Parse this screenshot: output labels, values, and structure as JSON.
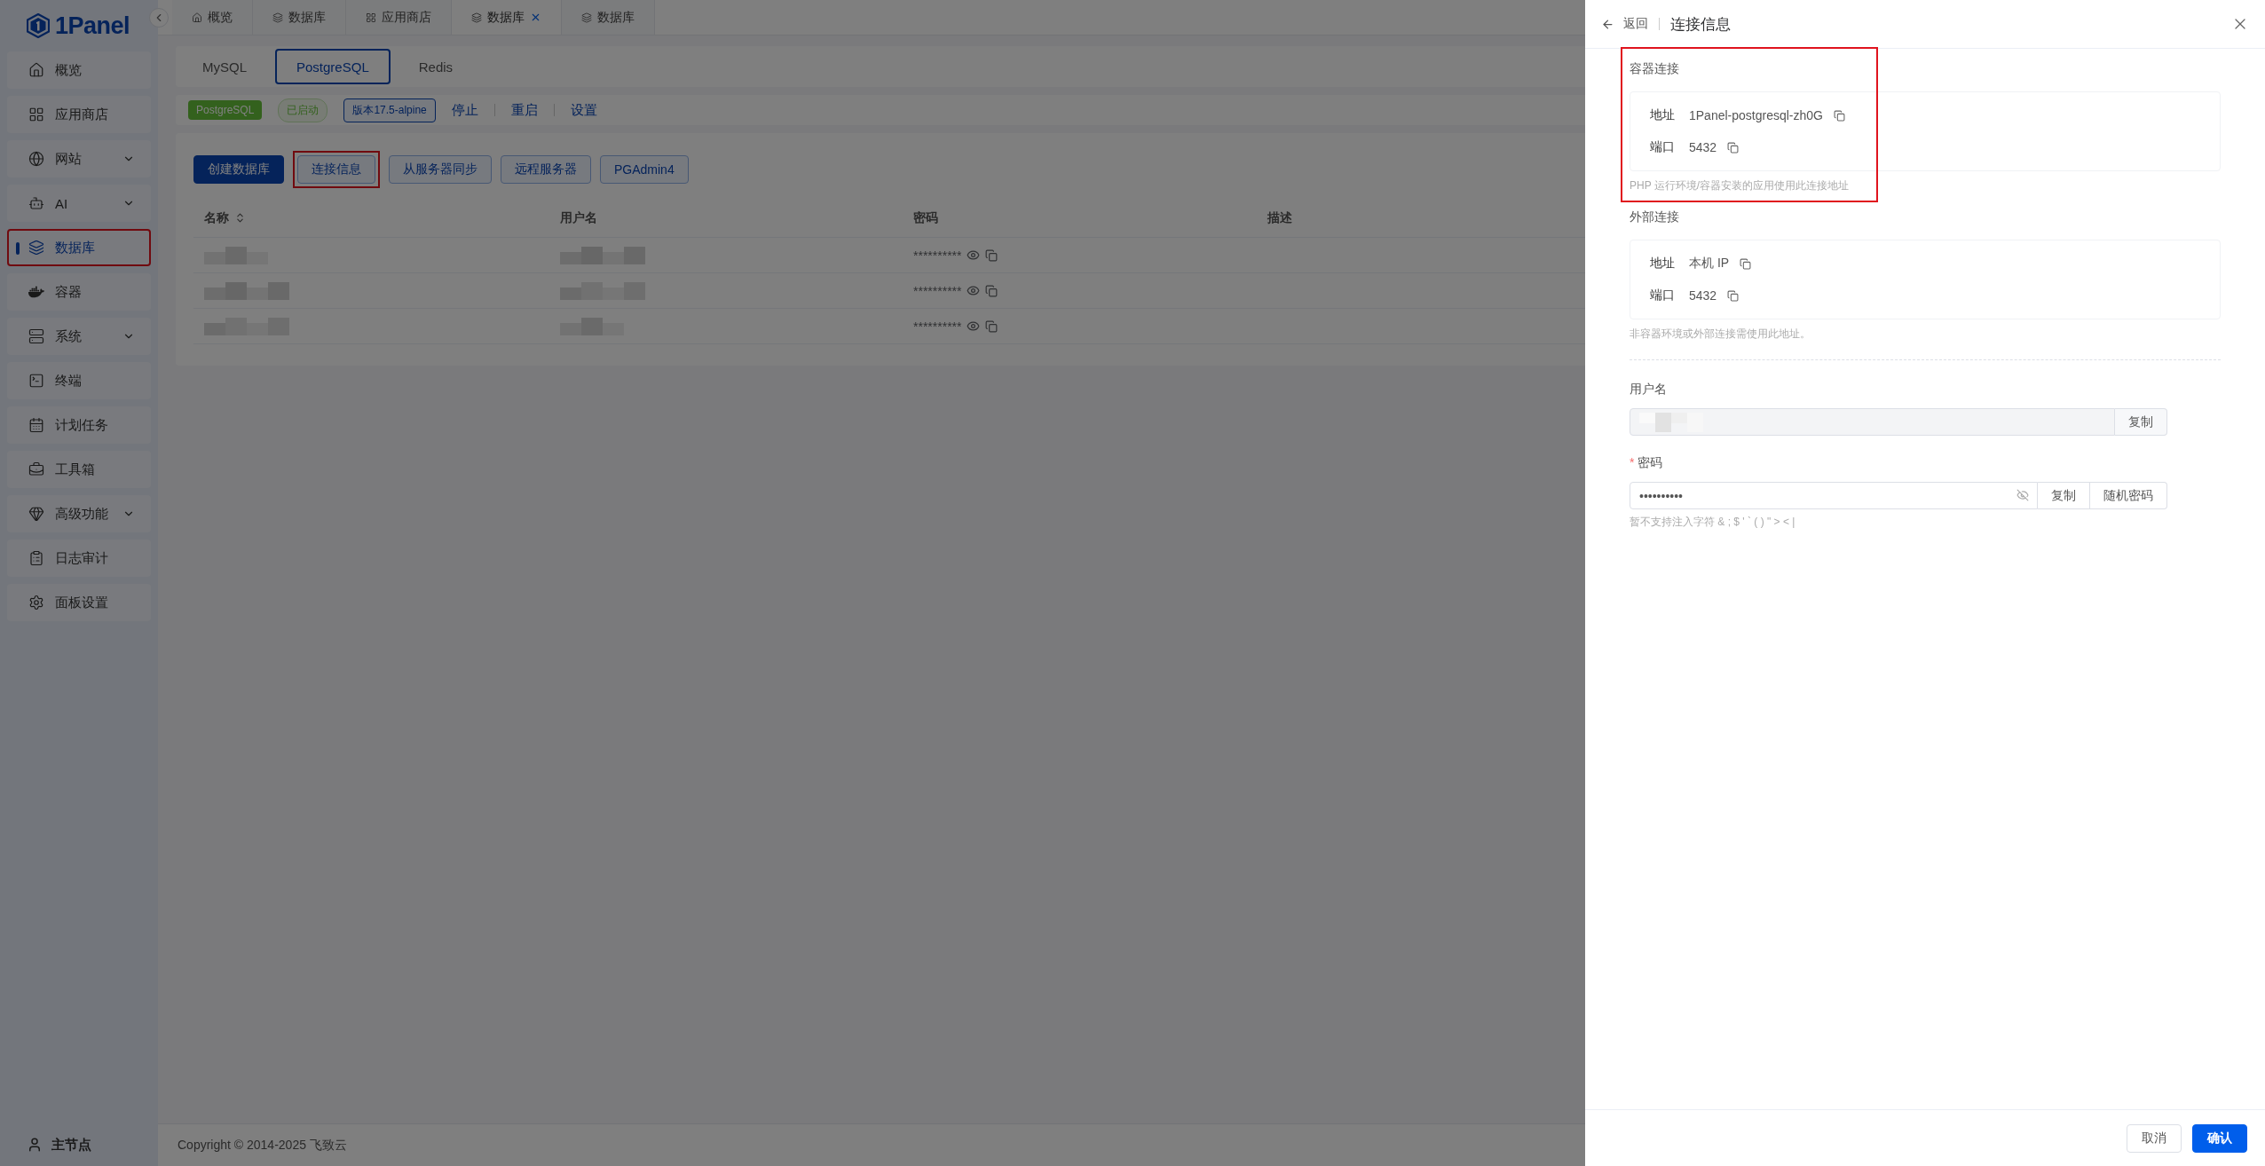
{
  "logo": {
    "text": "1Panel"
  },
  "sidebar": {
    "items": [
      {
        "label": "概览",
        "expandable": false,
        "selected": false,
        "highlighted": false
      },
      {
        "label": "应用商店",
        "expandable": false,
        "selected": false,
        "highlighted": false
      },
      {
        "label": "网站",
        "expandable": true,
        "selected": false,
        "highlighted": false
      },
      {
        "label": "AI",
        "expandable": true,
        "selected": false,
        "highlighted": false
      },
      {
        "label": "数据库",
        "expandable": false,
        "selected": true,
        "highlighted": true
      },
      {
        "label": "容器",
        "expandable": false,
        "selected": false,
        "highlighted": false
      },
      {
        "label": "系统",
        "expandable": true,
        "selected": false,
        "highlighted": false
      },
      {
        "label": "终端",
        "expandable": false,
        "selected": false,
        "highlighted": false
      },
      {
        "label": "计划任务",
        "expandable": false,
        "selected": false,
        "highlighted": false
      },
      {
        "label": "工具箱",
        "expandable": false,
        "selected": false,
        "highlighted": false
      },
      {
        "label": "高级功能",
        "expandable": true,
        "selected": false,
        "highlighted": false
      },
      {
        "label": "日志审计",
        "expandable": false,
        "selected": false,
        "highlighted": false
      },
      {
        "label": "面板设置",
        "expandable": false,
        "selected": false,
        "highlighted": false
      }
    ],
    "footer": {
      "label": "主节点"
    }
  },
  "top_tabs": [
    {
      "label": "概览",
      "closable": false
    },
    {
      "label": "数据库",
      "closable": false
    },
    {
      "label": "应用商店",
      "closable": false
    },
    {
      "label": "数据库",
      "closable": true
    },
    {
      "label": "数据库",
      "closable": false
    }
  ],
  "db_tabs": [
    {
      "label": "MySQL",
      "selected": false
    },
    {
      "label": "PostgreSQL",
      "selected": true
    },
    {
      "label": "Redis",
      "selected": false
    }
  ],
  "status_bar": {
    "app": "PostgreSQL",
    "status": "已启动",
    "version": "版本17.5-alpine",
    "actions": [
      "停止",
      "重启",
      "设置"
    ]
  },
  "toolbar": [
    {
      "label": "创建数据库",
      "primary": true,
      "highlighted": false
    },
    {
      "label": "连接信息",
      "primary": false,
      "highlighted": true
    },
    {
      "label": "从服务器同步",
      "primary": false,
      "highlighted": false
    },
    {
      "label": "远程服务器",
      "primary": false,
      "highlighted": false
    },
    {
      "label": "PGAdmin4",
      "primary": false,
      "highlighted": false
    }
  ],
  "table": {
    "columns": [
      {
        "label": "名称",
        "sortable": true
      },
      {
        "label": "用户名",
        "sortable": false
      },
      {
        "label": "密码",
        "sortable": false
      },
      {
        "label": "描述",
        "sortable": false
      }
    ],
    "rows": [
      {
        "password": "**********"
      },
      {
        "password": "**********"
      },
      {
        "password": "**********"
      }
    ]
  },
  "footer": "Copyright © 2014-2025 飞致云",
  "drawer": {
    "back": "返回",
    "title": "连接信息",
    "sections": [
      {
        "title": "容器连接",
        "highlighted": true,
        "fields": [
          {
            "label": "地址",
            "value": "1Panel-postgresql-zh0G"
          },
          {
            "label": "端口",
            "value": "5432"
          }
        ],
        "note": "PHP 运行环境/容器安装的应用使用此连接地址"
      },
      {
        "title": "外部连接",
        "highlighted": false,
        "fields": [
          {
            "label": "地址",
            "value": "本机 IP"
          },
          {
            "label": "端口",
            "value": "5432"
          }
        ],
        "note": "非容器环境或外部连接需使用此地址。"
      }
    ],
    "username": {
      "label": "用户名",
      "button": "复制"
    },
    "password": {
      "label": "密码",
      "required_mark": "*",
      "value": "••••••••••",
      "buttons": [
        "复制",
        "随机密码"
      ],
      "hint": "暂不支持注入字符 & ; $ ' ` ( ) \" > < |"
    },
    "buttons": [
      {
        "label": "取消",
        "primary": false
      },
      {
        "label": "确认",
        "primary": true
      }
    ]
  }
}
